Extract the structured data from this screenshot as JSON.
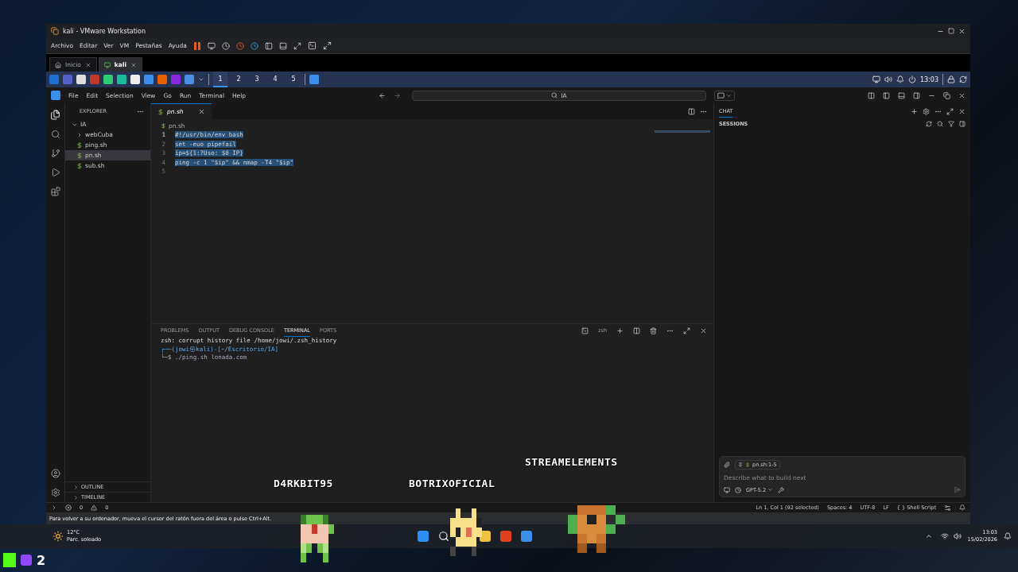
{
  "vmware": {
    "title": "kali - VMware Workstation",
    "menu": [
      "Archivo",
      "Editar",
      "Ver",
      "VM",
      "Pestañas",
      "Ayuda"
    ],
    "tabs": [
      {
        "label": "Inicio",
        "selected": false
      },
      {
        "label": "kali",
        "selected": true
      }
    ],
    "status_message": "Para volver a su ordenador, mueva el cursor del ratón fuera del área o pulse Ctrl+Alt."
  },
  "kali_panel": {
    "workspaces": [
      {
        "label": "1",
        "selected": true
      },
      {
        "label": "2",
        "selected": false
      },
      {
        "label": "3",
        "selected": false
      },
      {
        "label": "4",
        "selected": false
      },
      {
        "label": "5",
        "selected": false
      }
    ],
    "clock": "13:03"
  },
  "vscode": {
    "menu": [
      "File",
      "Edit",
      "Selection",
      "View",
      "Go",
      "Run",
      "Terminal",
      "Help"
    ],
    "search": "IA",
    "explorer": {
      "title": "EXPLORER",
      "folder": "IA",
      "items": [
        {
          "label": "webCuba",
          "kind": "folder",
          "selected": false
        },
        {
          "label": "ping.sh",
          "kind": "file",
          "selected": false
        },
        {
          "label": "pn.sh",
          "kind": "file",
          "selected": true
        },
        {
          "label": "sub.sh",
          "kind": "file",
          "selected": false
        }
      ],
      "sections": [
        "OUTLINE",
        "TIMELINE"
      ]
    },
    "editor": {
      "tab": "pn.sh",
      "breadcrumb": "pn.sh",
      "lines": [
        {
          "number": "1",
          "text": "#!/usr/bin/env bash"
        },
        {
          "number": "2",
          "text": "set -euo pipefail"
        },
        {
          "number": "3",
          "text": "ip=${1:?Uso: $0 IP}"
        },
        {
          "number": "4",
          "text": "ping -c 1 \"$ip\" && nmap -T4 \"$ip\""
        },
        {
          "number": "5"
        }
      ]
    },
    "panel_tabs": [
      {
        "label": "PROBLEMS",
        "selected": false
      },
      {
        "label": "OUTPUT",
        "selected": false
      },
      {
        "label": "DEBUG CONSOLE",
        "selected": false
      },
      {
        "label": "TERMINAL",
        "selected": true
      },
      {
        "label": "PORTS",
        "selected": false
      }
    ],
    "terminal_name": "zsh",
    "terminal_lines": [
      {
        "kind": "output",
        "text": "zsh: corrupt history file /home/jowi/.zsh_history"
      },
      {
        "kind": "prompt",
        "text": "┌──(jowi㉿kali)-[~/Escritorio/IA]"
      },
      {
        "kind": "command",
        "text": "└─$ ./ping.sh lonada.com"
      }
    ],
    "chat": {
      "title": "CHAT",
      "sessions": "SESSIONS",
      "context": "pn.sh:1-5",
      "placeholder": "Describe what to build next",
      "model": "GPT-5.2"
    },
    "status_bar": {
      "errors": "0",
      "warnings": "0",
      "items": [
        "Ln 1, Col 1 (92 selected)",
        "Spaces: 4",
        "UTF-8",
        "LF",
        "{ } Shell Script"
      ]
    }
  },
  "windows_taskbar": {
    "temperature": "12°C",
    "weather": "Parc. soleado",
    "time": "13:03",
    "date": "15/02/2026"
  },
  "overlay": {
    "names": [
      "D4RKBIT95",
      "BOTRIXOFICIAL",
      "STREAMELEMENTS"
    ],
    "counter": "2"
  }
}
